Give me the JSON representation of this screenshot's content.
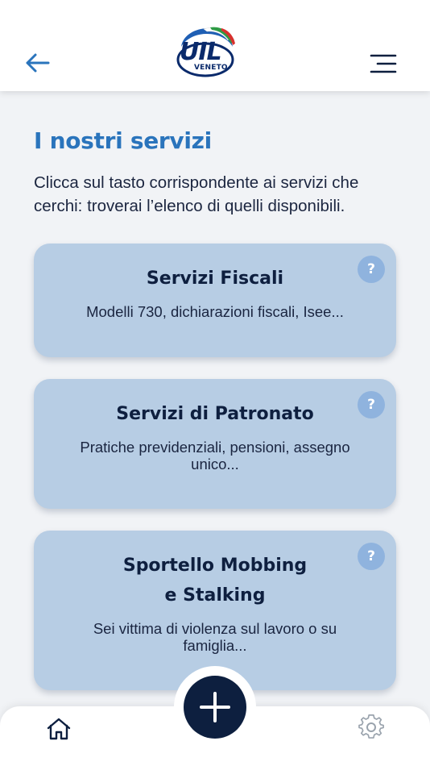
{
  "header": {
    "back_icon": "arrow-left-icon",
    "menu_icon": "hamburger-menu-icon",
    "logo": {
      "main": "UIL",
      "sub": "VENETO"
    }
  },
  "main": {
    "title": "I nostri servizi",
    "intro": "Clicca sul tasto corrispondente ai servizi che cerchi: troverai l’elenco di quelli disponibili.",
    "cards": [
      {
        "title": "Servizi Fiscali",
        "description": "Modelli 730, dichiarazioni fiscali, Isee...",
        "help": "?"
      },
      {
        "title": "Servizi di Patronato",
        "description": "Pratiche previdenziali, pensioni, assegno unico...",
        "help": "?"
      },
      {
        "title_line1": "Sportello Mobbing",
        "title_line2": "e Stalking",
        "description": "Sei vittima di violenza sul lavoro o su famiglia...",
        "help": "?"
      }
    ]
  },
  "bottom_nav": {
    "home_icon": "home-icon",
    "add_icon": "plus-icon",
    "settings_icon": "gear-icon"
  },
  "colors": {
    "accent": "#2a74bc",
    "card_bg": "#b7cde4",
    "help_bg": "#8fb3de",
    "dark_navy": "#0d1f3f",
    "page_bg": "#f1f3f6"
  }
}
